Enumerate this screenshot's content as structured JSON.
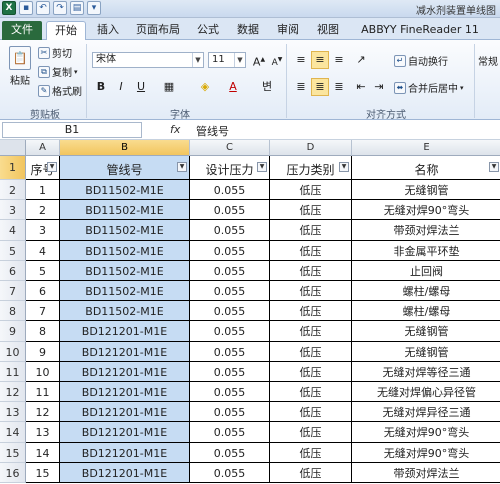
{
  "window": {
    "title": "减水剂装置单线图"
  },
  "tabs": [
    "文件",
    "开始",
    "插入",
    "页面布局",
    "公式",
    "数据",
    "审阅",
    "视图",
    "ABBYY FineReader 11"
  ],
  "active_tab": "开始",
  "ribbon": {
    "clipboard": {
      "paste": "粘贴",
      "cut": "剪切",
      "copy": "复制",
      "format_painter": "格式刷",
      "group_label": "剪贴板"
    },
    "font": {
      "name": "宋体",
      "size": "11",
      "group_label": "字体"
    },
    "alignment": {
      "wrap": "自动换行",
      "merge": "合并后居中",
      "group_label": "对齐方式"
    },
    "number": {
      "format": "常规"
    }
  },
  "formula_bar": {
    "name_box": "B1",
    "fx": "fx",
    "value": "管线号"
  },
  "columns": [
    "A",
    "B",
    "C",
    "D",
    "E"
  ],
  "selected_column": "B",
  "headers": {
    "A": "序号",
    "B": "管线号",
    "C": "设计压力",
    "D": "压力类别",
    "E": "名称"
  },
  "rows": [
    {
      "row": "2",
      "A": "1",
      "B": "BD11502-M1E",
      "C": "0.055",
      "D": "低压",
      "E": "无缝钢管"
    },
    {
      "row": "3",
      "A": "2",
      "B": "BD11502-M1E",
      "C": "0.055",
      "D": "低压",
      "E": "无缝对焊90°弯头"
    },
    {
      "row": "4",
      "A": "3",
      "B": "BD11502-M1E",
      "C": "0.055",
      "D": "低压",
      "E": "带颈对焊法兰"
    },
    {
      "row": "5",
      "A": "4",
      "B": "BD11502-M1E",
      "C": "0.055",
      "D": "低压",
      "E": "非金属平环垫"
    },
    {
      "row": "6",
      "A": "5",
      "B": "BD11502-M1E",
      "C": "0.055",
      "D": "低压",
      "E": "止回阀"
    },
    {
      "row": "7",
      "A": "6",
      "B": "BD11502-M1E",
      "C": "0.055",
      "D": "低压",
      "E": "螺柱/螺母"
    },
    {
      "row": "8",
      "A": "7",
      "B": "BD11502-M1E",
      "C": "0.055",
      "D": "低压",
      "E": "螺柱/螺母"
    },
    {
      "row": "9",
      "A": "8",
      "B": "BD121201-M1E",
      "C": "0.055",
      "D": "低压",
      "E": "无缝钢管"
    },
    {
      "row": "10",
      "A": "9",
      "B": "BD121201-M1E",
      "C": "0.055",
      "D": "低压",
      "E": "无缝钢管"
    },
    {
      "row": "11",
      "A": "10",
      "B": "BD121201-M1E",
      "C": "0.055",
      "D": "低压",
      "E": "无缝对焊等径三通"
    },
    {
      "row": "12",
      "A": "11",
      "B": "BD121201-M1E",
      "C": "0.055",
      "D": "低压",
      "E": "无缝对焊偏心异径管"
    },
    {
      "row": "13",
      "A": "12",
      "B": "BD121201-M1E",
      "C": "0.055",
      "D": "低压",
      "E": "无缝对焊异径三通"
    },
    {
      "row": "14",
      "A": "13",
      "B": "BD121201-M1E",
      "C": "0.055",
      "D": "低压",
      "E": "无缝对焊90°弯头"
    },
    {
      "row": "15",
      "A": "14",
      "B": "BD121201-M1E",
      "C": "0.055",
      "D": "低压",
      "E": "无缝对焊90°弯头"
    },
    {
      "row": "16",
      "A": "15",
      "B": "BD121201-M1E",
      "C": "0.055",
      "D": "低压",
      "E": "带颈对焊法兰"
    }
  ],
  "colors": {
    "selection": "#c6dcf3",
    "header_highlight": "#f2c55e",
    "file_tab": "#2a6a3d"
  }
}
